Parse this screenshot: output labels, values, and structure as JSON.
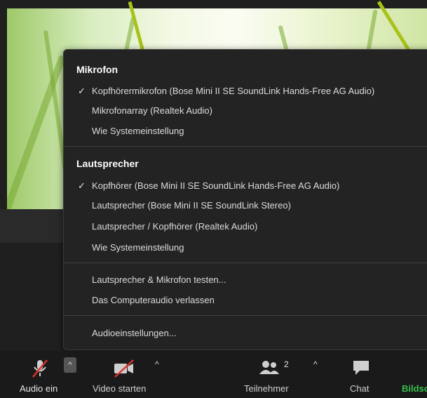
{
  "menu": {
    "mikrofon_title": "Mikrofon",
    "mikrofon_items": [
      {
        "label": "Kopfhörermikrofon (Bose Mini II SE SoundLink Hands-Free AG Audio)",
        "checked": true
      },
      {
        "label": "Mikrofonarray (Realtek Audio)",
        "checked": false
      },
      {
        "label": "Wie Systemeinstellung",
        "checked": false
      }
    ],
    "lautsprecher_title": "Lautsprecher",
    "lautsprecher_items": [
      {
        "label": "Kopfhörer (Bose Mini II SE SoundLink Hands-Free AG Audio)",
        "checked": true
      },
      {
        "label": "Lautsprecher (Bose Mini II SE SoundLink Stereo)",
        "checked": false
      },
      {
        "label": "Lautsprecher / Kopfhörer (Realtek Audio)",
        "checked": false
      },
      {
        "label": "Wie Systemeinstellung",
        "checked": false
      }
    ],
    "actions": [
      {
        "label": "Lautsprecher & Mikrofon testen..."
      },
      {
        "label": "Das Computeraudio verlassen"
      }
    ],
    "settings_label": "Audioeinstellungen...",
    "check_glyph": "✓"
  },
  "toolbar": {
    "audio_label": "Audio ein",
    "video_label": "Video starten",
    "participants_label": "Teilnehmer",
    "participants_count": "2",
    "chat_label": "Chat",
    "share_label": "Bildsc",
    "caret": "^",
    "share_color": "#35c24a"
  }
}
